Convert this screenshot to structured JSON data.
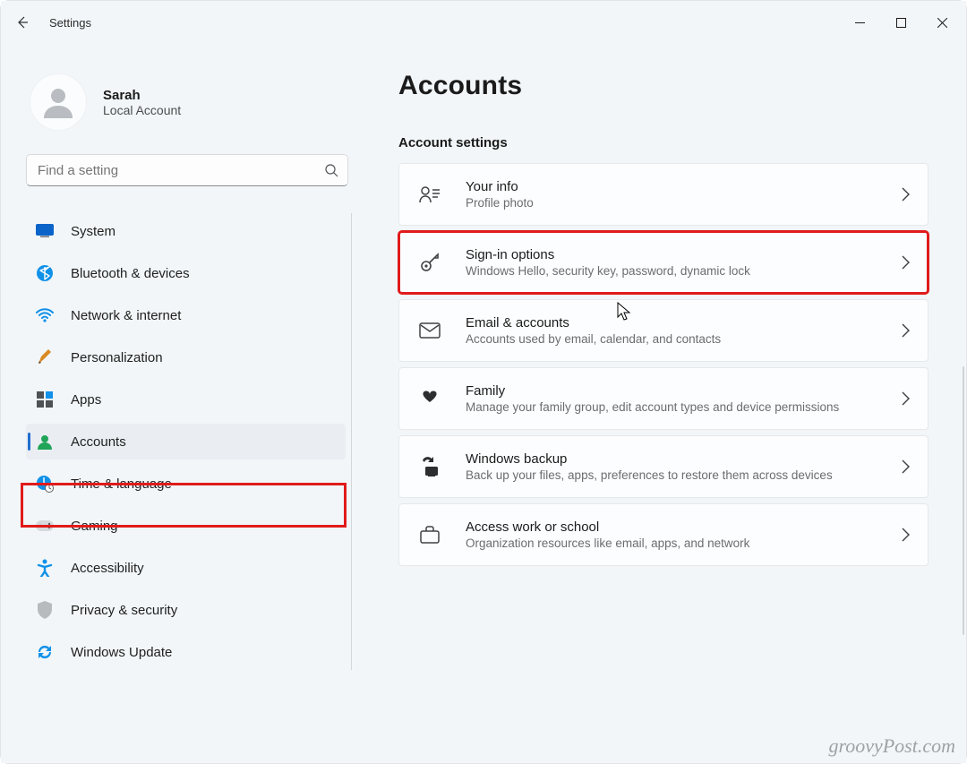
{
  "app": {
    "title": "Settings"
  },
  "user": {
    "name": "Sarah",
    "subtitle": "Local Account"
  },
  "search": {
    "placeholder": "Find a setting"
  },
  "nav": [
    {
      "id": "system",
      "label": "System"
    },
    {
      "id": "bluetooth",
      "label": "Bluetooth & devices"
    },
    {
      "id": "network",
      "label": "Network & internet"
    },
    {
      "id": "personalization",
      "label": "Personalization"
    },
    {
      "id": "apps",
      "label": "Apps"
    },
    {
      "id": "accounts",
      "label": "Accounts",
      "active": true
    },
    {
      "id": "time",
      "label": "Time & language"
    },
    {
      "id": "gaming",
      "label": "Gaming"
    },
    {
      "id": "accessibility",
      "label": "Accessibility"
    },
    {
      "id": "privacy",
      "label": "Privacy & security"
    },
    {
      "id": "update",
      "label": "Windows Update"
    }
  ],
  "page": {
    "title": "Accounts",
    "section": "Account settings",
    "items": [
      {
        "id": "your-info",
        "title": "Your info",
        "sub": "Profile photo"
      },
      {
        "id": "signin-options",
        "title": "Sign-in options",
        "sub": "Windows Hello, security key, password, dynamic lock",
        "highlight": true
      },
      {
        "id": "email-accounts",
        "title": "Email & accounts",
        "sub": "Accounts used by email, calendar, and contacts"
      },
      {
        "id": "family",
        "title": "Family",
        "sub": "Manage your family group, edit account types and device permissions"
      },
      {
        "id": "windows-backup",
        "title": "Windows backup",
        "sub": "Back up your files, apps, preferences to restore them across devices"
      },
      {
        "id": "work-school",
        "title": "Access work or school",
        "sub": "Organization resources like email, apps, and network"
      }
    ]
  },
  "watermark": "groovyPost.com"
}
